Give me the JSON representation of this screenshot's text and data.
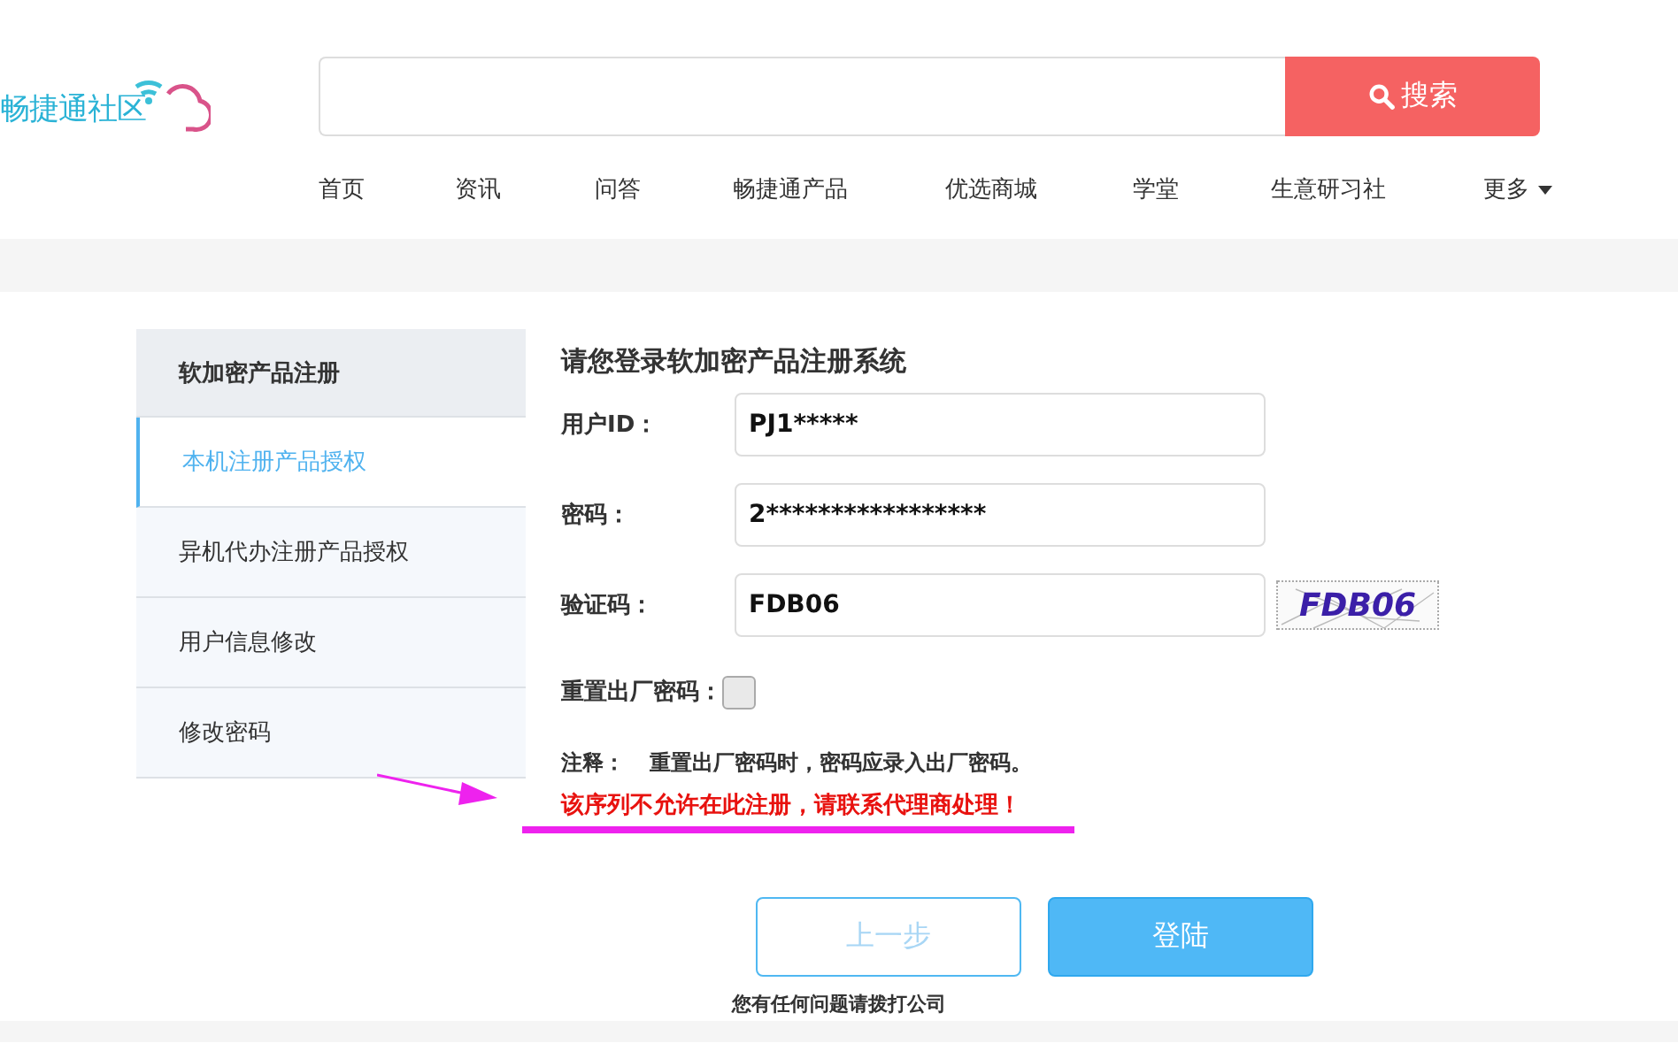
{
  "logo": {
    "text": "畅捷通社区"
  },
  "search": {
    "button": "搜索"
  },
  "nav": [
    {
      "label": "首页",
      "dropdown": false
    },
    {
      "label": "资讯",
      "dropdown": false
    },
    {
      "label": "问答",
      "dropdown": false
    },
    {
      "label": "畅捷通产品",
      "dropdown": false
    },
    {
      "label": "优选商城",
      "dropdown": false
    },
    {
      "label": "学堂",
      "dropdown": false
    },
    {
      "label": "生意研习社",
      "dropdown": false
    },
    {
      "label": "更多",
      "dropdown": true
    }
  ],
  "sidebar": {
    "title": "软加密产品注册",
    "items": [
      {
        "label": "本机注册产品授权",
        "selected": true
      },
      {
        "label": "异机代办注册产品授权",
        "selected": false
      },
      {
        "label": "用户信息修改",
        "selected": false
      },
      {
        "label": "修改密码",
        "selected": false
      }
    ]
  },
  "form": {
    "title": "请您登录软加密产品注册系统",
    "fields": [
      {
        "label": "用户ID：",
        "value": "PJ1*****"
      },
      {
        "label": "密码：",
        "value": "2*****************"
      },
      {
        "label": "验证码：",
        "value": "FDB06",
        "captcha": "FDB06"
      }
    ],
    "reset": {
      "label": "重置出厂密码：",
      "checked": false
    },
    "note_label": "注释：",
    "note": "重置出厂密码时，密码应录入出厂密码。",
    "error": "该序列不允许在此注册，请联系代理商处理！",
    "buttons": [
      {
        "label": "上一步",
        "primary": false
      },
      {
        "label": "登陆",
        "primary": true
      }
    ],
    "footer": "您有任何问题请拨打公司"
  }
}
